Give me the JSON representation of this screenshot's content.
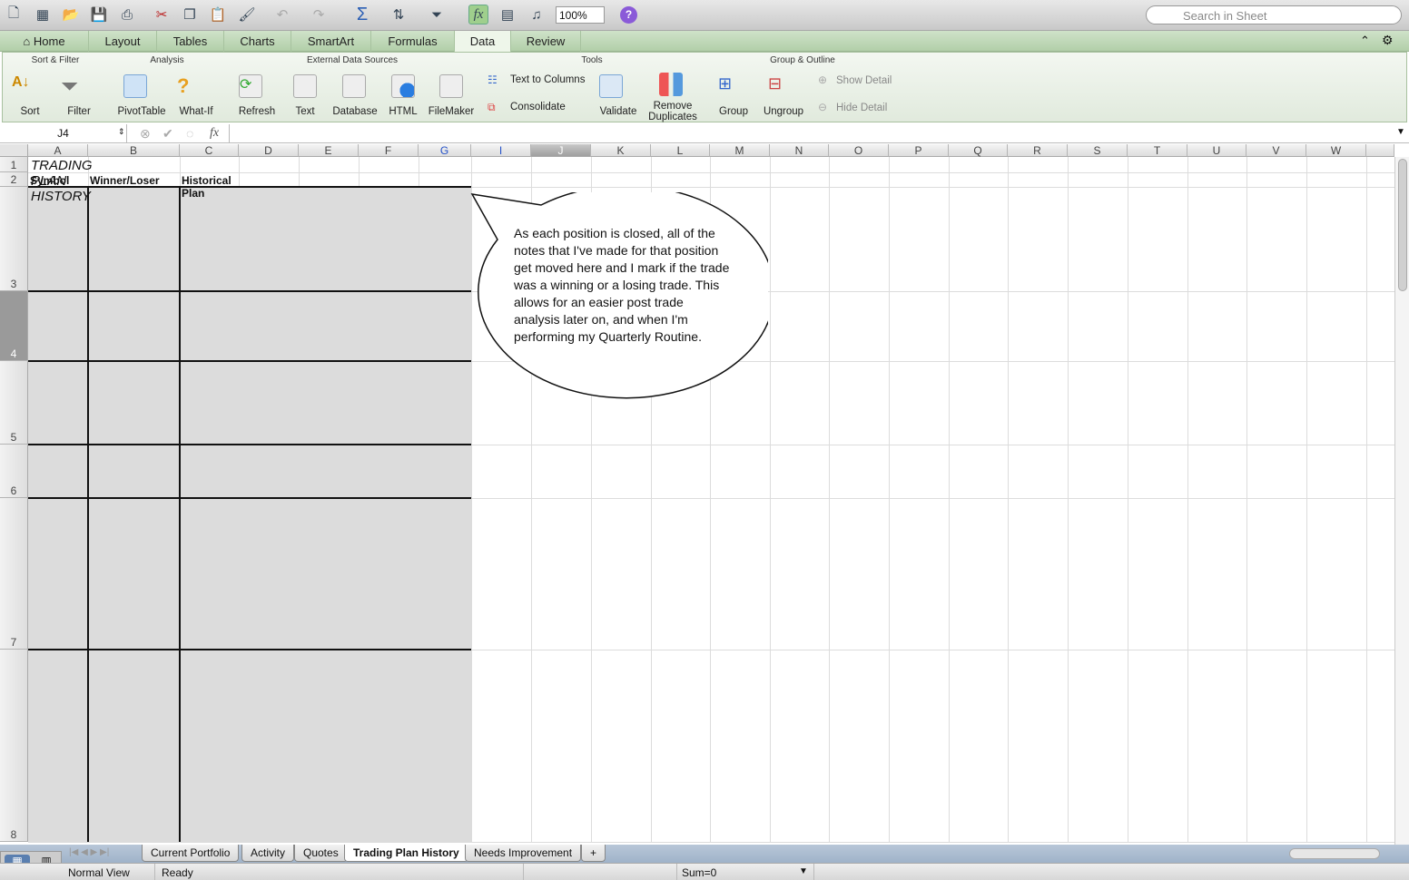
{
  "toolbar": {
    "zoom": "100%",
    "search_placeholder": "Search in Sheet",
    "help": "?"
  },
  "ribbon_tabs": [
    "Home",
    "Layout",
    "Tables",
    "Charts",
    "SmartArt",
    "Formulas",
    "Data",
    "Review"
  ],
  "ribbon": {
    "groups": [
      "Sort & Filter",
      "Analysis",
      "External Data Sources",
      "Tools",
      "Group & Outline"
    ],
    "buttons": {
      "sort": "Sort",
      "filter": "Filter",
      "pivot": "PivotTable",
      "whatif": "What-If",
      "refresh": "Refresh",
      "text": "Text",
      "database": "Database",
      "html": "HTML",
      "filemaker": "FileMaker",
      "text_to_columns": "Text to Columns",
      "consolidate": "Consolidate",
      "validate": "Validate",
      "remove_dup_1": "Remove",
      "remove_dup_2": "Duplicates",
      "group": "Group",
      "ungroup": "Ungroup",
      "show_detail": "Show Detail",
      "hide_detail": "Hide Detail"
    }
  },
  "formula_bar": {
    "name_box": "J4",
    "fx": "fx",
    "value": ""
  },
  "columns": [
    "A",
    "B",
    "C",
    "D",
    "E",
    "F",
    "G",
    "I",
    "J",
    "K",
    "L",
    "M",
    "N",
    "O",
    "P",
    "Q",
    "R",
    "S",
    "T",
    "U",
    "V",
    "W"
  ],
  "rows": [
    "1",
    "2",
    "3",
    "4",
    "5",
    "6",
    "7",
    "8"
  ],
  "cells": {
    "A1": "TRADING PLAN HISTORY",
    "A2": "Symbol",
    "B2": "Winner/Loser",
    "C2": "Historical Plan"
  },
  "callout": "As each position is closed, all of the notes that I've made for that position get moved here and I mark if the trade was a winning or a losing trade.  This allows for an easier post trade analysis later on, and when I'm performing my Quarterly Routine.",
  "sheet_tabs": [
    "Current Portfolio",
    "Activity",
    "Quotes",
    "Trading Plan History",
    "Needs Improvement",
    "+"
  ],
  "active_sheet": "Trading Plan History",
  "status": {
    "view": "Normal View",
    "state": "Ready",
    "sum": "Sum=0"
  }
}
